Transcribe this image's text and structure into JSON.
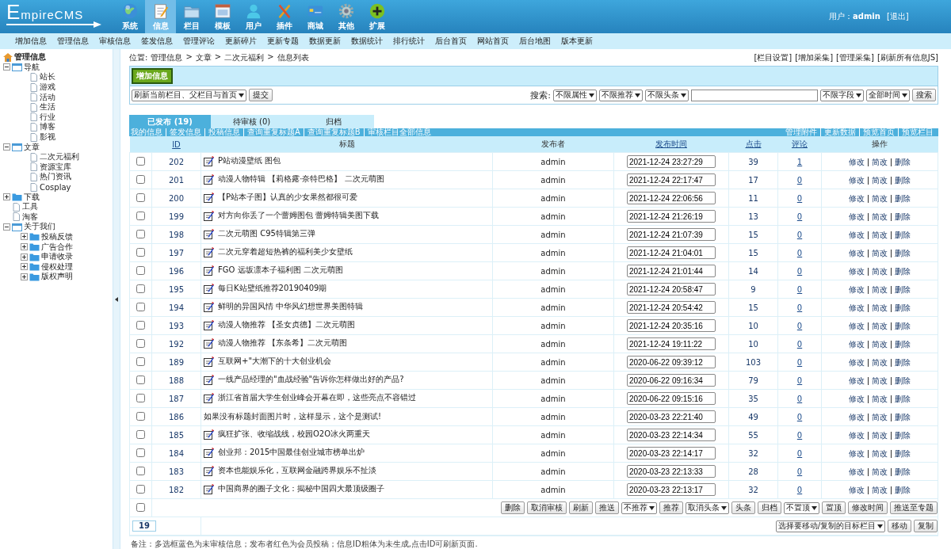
{
  "header": {
    "logo": "EmpireCMS",
    "nav": [
      {
        "label": "系统",
        "selected": false
      },
      {
        "label": "信息",
        "selected": true
      },
      {
        "label": "栏目",
        "selected": false
      },
      {
        "label": "模板",
        "selected": false
      },
      {
        "label": "用户",
        "selected": false
      },
      {
        "label": "插件",
        "selected": false
      },
      {
        "label": "商城",
        "selected": false
      },
      {
        "label": "其他",
        "selected": false
      },
      {
        "label": "扩展",
        "selected": false
      }
    ],
    "user": "用户：**admin**",
    "logout": "[退出]"
  },
  "subnav": [
    "增加信息",
    "管理信息",
    "审核信息",
    "签发信息",
    "管理评论",
    "更新碎片",
    "更新专题",
    "数据更新",
    "数据统计",
    "排行统计",
    "后台首页",
    "网站首页",
    "后台地图",
    "版本更新"
  ],
  "sidebar": {
    "root": "管理信息",
    "tree": [
      {
        "label": "导航",
        "kind": "folder",
        "expanded": true,
        "children": [
          {
            "label": "站长",
            "kind": "page"
          },
          {
            "label": "游戏",
            "kind": "page"
          },
          {
            "label": "活动",
            "kind": "page"
          },
          {
            "label": "生活",
            "kind": "page"
          },
          {
            "label": "行业",
            "kind": "page"
          },
          {
            "label": "博客",
            "kind": "page"
          },
          {
            "label": "影视",
            "kind": "page"
          }
        ]
      },
      {
        "label": "文章",
        "kind": "folder",
        "expanded": true,
        "children": [
          {
            "label": "二次元福利",
            "kind": "page"
          },
          {
            "label": "资源宝库",
            "kind": "page"
          },
          {
            "label": "热门资讯",
            "kind": "page"
          },
          {
            "label": "Cosplay",
            "kind": "page"
          }
        ]
      },
      {
        "label": "下载",
        "kind": "folder",
        "expanded": false
      },
      {
        "label": "工具",
        "kind": "page"
      },
      {
        "label": "淘客",
        "kind": "page"
      },
      {
        "label": "关于我们",
        "kind": "folder",
        "expanded": true,
        "children": [
          {
            "label": "投稿反馈",
            "kind": "folder",
            "expanded": false
          },
          {
            "label": "广告合作",
            "kind": "folder",
            "expanded": false
          },
          {
            "label": "申请收录",
            "kind": "folder",
            "expanded": false
          },
          {
            "label": "侵权处理",
            "kind": "folder",
            "expanded": false
          },
          {
            "label": "版权声明",
            "kind": "folder",
            "expanded": false
          }
        ]
      }
    ]
  },
  "breadcrumb": {
    "label": "位置:",
    "path": [
      "管理信息",
      "文章",
      "二次元福利",
      "信息列表"
    ],
    "separator": ">"
  },
  "top_links": [
    "[栏目设置]",
    "[增加采集]",
    "[管理采集]",
    "[刷新所有信息JS]"
  ],
  "add_button": "增加信息",
  "refresh": {
    "select": "刷新当前栏目、父栏目与首页",
    "button": "提交"
  },
  "search": {
    "label": "搜索:",
    "filters": [
      "不限属性",
      "不限推荐",
      "不限头条"
    ],
    "field_filters": [
      "不限字段",
      "全部时间"
    ],
    "button": "搜索"
  },
  "tabs": [
    {
      "label": "已发布 (19)",
      "selected": true
    },
    {
      "label": "待审核 (0)",
      "selected": false
    },
    {
      "label": "归档",
      "selected": false
    }
  ],
  "links_left": [
    "我的信息",
    "签发信息",
    "投稿信息",
    "查询重复标题A",
    "查询重复标题B",
    "审核栏目全部信息"
  ],
  "links_right": [
    "管理附件",
    "更新数据",
    "预览首页",
    "预览栏目"
  ],
  "table": {
    "columns": [
      {
        "label": "ID",
        "sortable": true
      },
      {
        "label": "标题",
        "sortable": false
      },
      {
        "label": "发布者",
        "sortable": false
      },
      {
        "label": "发布时间",
        "sortable": true
      },
      {
        "label": "点击",
        "sortable": true
      },
      {
        "label": "评论",
        "sortable": true
      },
      {
        "label": "操作",
        "sortable": false
      }
    ],
    "rows": [
      {
        "checked": false,
        "id": "202",
        "has_image": true,
        "title": "P站动漫壁纸 图包",
        "author": "admin",
        "time": "2021-12-24 23:27:29",
        "clicks": "39",
        "comments": "1",
        "actions": [
          "修改",
          "简改",
          "删除"
        ]
      },
      {
        "checked": false,
        "id": "201",
        "has_image": true,
        "title": "动漫人物特辑 【莉格露·奈特巴格】 二次元萌图",
        "author": "admin",
        "time": "2021-12-24 22:17:47",
        "clicks": "17",
        "comments": "0",
        "actions": [
          "修改",
          "简改",
          "删除"
        ]
      },
      {
        "checked": false,
        "id": "200",
        "has_image": true,
        "title": "【P站本子图】认真的少女果然都很可爱",
        "author": "admin",
        "time": "2021-12-24 22:06:56",
        "clicks": "11",
        "comments": "0",
        "actions": [
          "修改",
          "简改",
          "删除"
        ]
      },
      {
        "checked": false,
        "id": "199",
        "has_image": true,
        "title": "对方向你丢了一个蕾姆图包 蕾姆特辑美图下载",
        "author": "admin",
        "time": "2021-12-24 21:26:19",
        "clicks": "13",
        "comments": "0",
        "actions": [
          "修改",
          "简改",
          "删除"
        ]
      },
      {
        "checked": false,
        "id": "198",
        "has_image": true,
        "title": "二次元萌图 C95特辑第三弹",
        "author": "admin",
        "time": "2021-12-24 21:07:39",
        "clicks": "15",
        "comments": "0",
        "actions": [
          "修改",
          "简改",
          "删除"
        ]
      },
      {
        "checked": false,
        "id": "197",
        "has_image": true,
        "title": "二次元穿着超短热裤的福利美少女壁纸",
        "author": "admin",
        "time": "2021-12-24 21:04:01",
        "clicks": "15",
        "comments": "0",
        "actions": [
          "修改",
          "简改",
          "删除"
        ]
      },
      {
        "checked": false,
        "id": "196",
        "has_image": true,
        "title": "FGO 远坂凛本子福利图 二次元萌图",
        "author": "admin",
        "time": "2021-12-24 21:01:44",
        "clicks": "14",
        "comments": "0",
        "actions": [
          "修改",
          "简改",
          "删除"
        ]
      },
      {
        "checked": false,
        "id": "195",
        "has_image": true,
        "title": "每日K站壁纸推荐20190409期",
        "author": "admin",
        "time": "2021-12-24 20:58:47",
        "clicks": "9",
        "comments": "0",
        "actions": [
          "修改",
          "简改",
          "删除"
        ]
      },
      {
        "checked": false,
        "id": "194",
        "has_image": true,
        "title": "鲜明的异国风情 中华风幻想世界美图特辑",
        "author": "admin",
        "time": "2021-12-24 20:54:42",
        "clicks": "15",
        "comments": "0",
        "actions": [
          "修改",
          "简改",
          "删除"
        ]
      },
      {
        "checked": false,
        "id": "193",
        "has_image": true,
        "title": "动漫人物推荐 【圣女贞德】二次元萌图",
        "author": "admin",
        "time": "2021-12-24 20:35:16",
        "clicks": "10",
        "comments": "0",
        "actions": [
          "修改",
          "简改",
          "删除"
        ]
      },
      {
        "checked": false,
        "id": "192",
        "has_image": true,
        "title": "动漫人物推荐 【东条希】二次元萌图",
        "author": "admin",
        "time": "2021-12-24 19:11:22",
        "clicks": "10",
        "comments": "0",
        "actions": [
          "修改",
          "简改",
          "删除"
        ]
      },
      {
        "checked": false,
        "id": "189",
        "has_image": true,
        "title": "互联网+\"大潮下的十大创业机会",
        "author": "admin",
        "time": "2020-06-22 09:39:12",
        "clicks": "103",
        "comments": "0",
        "actions": [
          "修改",
          "简改",
          "删除"
        ]
      },
      {
        "checked": false,
        "id": "188",
        "has_image": true,
        "title": "一线产品经理的\"血战经验\"告诉你怎样做出好的产品?",
        "author": "admin",
        "time": "2020-06-22 09:16:34",
        "clicks": "79",
        "comments": "0",
        "actions": [
          "修改",
          "简改",
          "删除"
        ]
      },
      {
        "checked": false,
        "id": "187",
        "has_image": true,
        "title": "浙江省首届大学生创业峰会开幕在即，这些亮点不容错过",
        "author": "admin",
        "time": "2020-06-22 09:15:16",
        "clicks": "35",
        "comments": "0",
        "actions": [
          "修改",
          "简改",
          "删除"
        ]
      },
      {
        "checked": false,
        "id": "186",
        "has_image": false,
        "title": "如果没有标题封面图片时，这样显示，这个是测试!",
        "author": "admin",
        "time": "2020-03-23 22:21:40",
        "clicks": "49",
        "comments": "0",
        "actions": [
          "修改",
          "简改",
          "删除"
        ]
      },
      {
        "checked": false,
        "id": "185",
        "has_image": true,
        "title": "疯狂扩张、收缩战线，校园O2O冰火两重天",
        "author": "admin",
        "time": "2020-03-23 22:14:34",
        "clicks": "55",
        "comments": "0",
        "actions": [
          "修改",
          "简改",
          "删除"
        ]
      },
      {
        "checked": false,
        "id": "184",
        "has_image": true,
        "title": "创业邦：2015中国最佳创业城市榜单出炉",
        "author": "admin",
        "time": "2020-03-23 22:14:17",
        "clicks": "32",
        "comments": "0",
        "actions": [
          "修改",
          "简改",
          "删除"
        ]
      },
      {
        "checked": false,
        "id": "183",
        "has_image": true,
        "title": "资本也能娱乐化，互联网金融跨界娱乐不扯淡",
        "author": "admin",
        "time": "2020-03-23 22:13:33",
        "clicks": "28",
        "comments": "0",
        "actions": [
          "修改",
          "简改",
          "删除"
        ]
      },
      {
        "checked": false,
        "id": "182",
        "has_image": true,
        "title": "中国商界的圈子文化：揭秘中国四大最顶级圈子",
        "author": "admin",
        "time": "2020-03-23 22:13:17",
        "clicks": "32",
        "comments": "0",
        "actions": [
          "修改",
          "简改",
          "删除"
        ]
      }
    ]
  },
  "select_all": {
    "checked": false
  },
  "bulk_actions": [
    {
      "kind": "button",
      "label": "删除"
    },
    {
      "kind": "button",
      "label": "取消审核"
    },
    {
      "kind": "button",
      "label": "刷新"
    },
    {
      "kind": "button",
      "label": "推送"
    },
    {
      "kind": "select",
      "label": "不推荐"
    },
    {
      "kind": "button",
      "label": "推荐"
    },
    {
      "kind": "select",
      "label": "取消头条"
    },
    {
      "kind": "button",
      "label": "头条"
    },
    {
      "kind": "button",
      "label": "归档"
    },
    {
      "kind": "select",
      "label": "不置顶"
    },
    {
      "kind": "button",
      "label": "置顶"
    },
    {
      "kind": "button",
      "label": "修改时间"
    },
    {
      "kind": "button",
      "label": "推送至专题"
    }
  ],
  "total": "19",
  "move": {
    "select": "选择要移动/复制的目标栏目",
    "buttons": [
      "移动",
      "复制"
    ]
  },
  "note": "备注：多选框蓝色为未审核信息；发布者红色为会员投稿；信息ID粗体为未生成,点击ID可刷新页面."
}
